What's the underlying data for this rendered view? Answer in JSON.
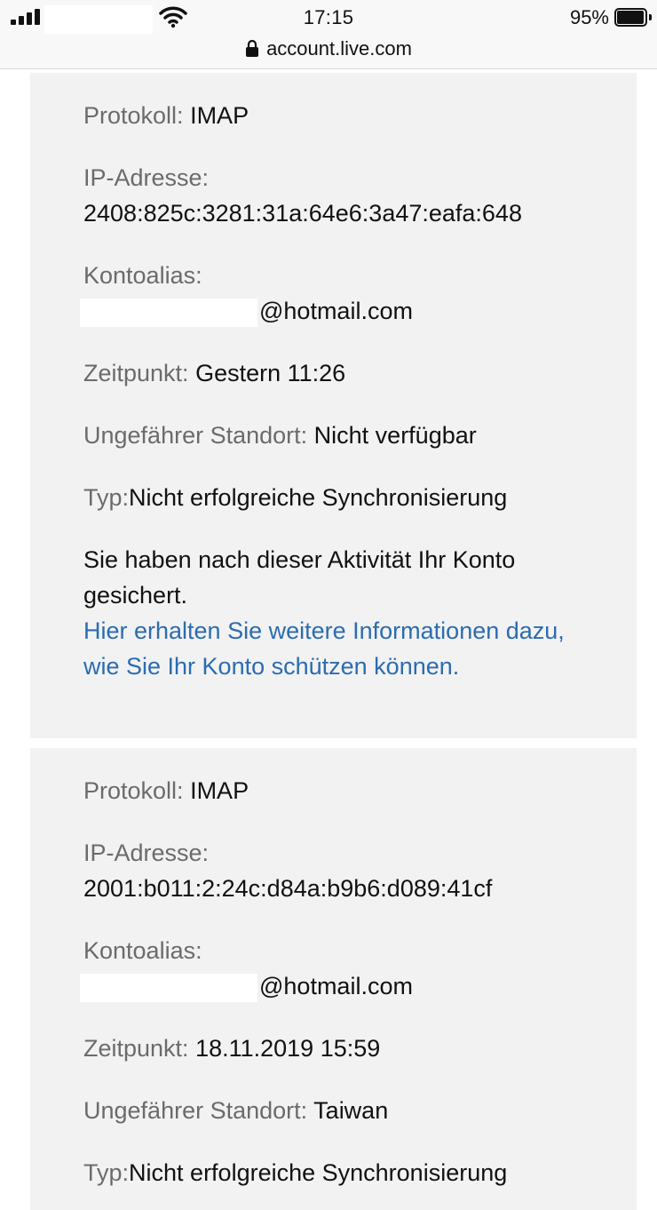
{
  "status_bar": {
    "time": "17:15",
    "battery_percent": "95%",
    "signal_bars": 4,
    "wifi_icon": "wifi-icon",
    "battery_icon": "battery-icon"
  },
  "address_bar": {
    "lock_icon": "lock-icon",
    "url": "account.live.com"
  },
  "activities": [
    {
      "protocol_label": "Protokoll: ",
      "protocol": "IMAP",
      "ip_label": "IP-Adresse:",
      "ip": "2408:825c:3281:31a:64e6:3a47:eafa:648",
      "alias_label": "Kontoalias:",
      "alias_domain": "@hotmail.com",
      "time_label": "Zeitpunkt: ",
      "time": "Gestern 11:26",
      "location_label": "Ungefährer Standort: ",
      "location": "Nicht verfügbar",
      "type_label": "Typ:",
      "type": "Nicht erfolgreiche Synchronisierung",
      "note": "Sie haben nach dieser Aktivität Ihr Konto gesichert.",
      "link": "Hier erhalten Sie weitere Informationen dazu, wie Sie Ihr Konto schützen können."
    },
    {
      "protocol_label": "Protokoll: ",
      "protocol": "IMAP",
      "ip_label": "IP-Adresse:",
      "ip": "2001:b011:2:24c:d84a:b9b6:d089:41cf",
      "alias_label": "Kontoalias:",
      "alias_domain": "@hotmail.com",
      "time_label": "Zeitpunkt: ",
      "time": "18.11.2019 15:59",
      "location_label": "Ungefährer Standort: ",
      "location": "Taiwan",
      "type_label": "Typ:",
      "type": "Nicht erfolgreiche Synchronisierung"
    }
  ],
  "colors": {
    "card_background": "#f2f2f2",
    "label_gray": "#6b6b6b",
    "link_blue": "#2b6cb0"
  }
}
